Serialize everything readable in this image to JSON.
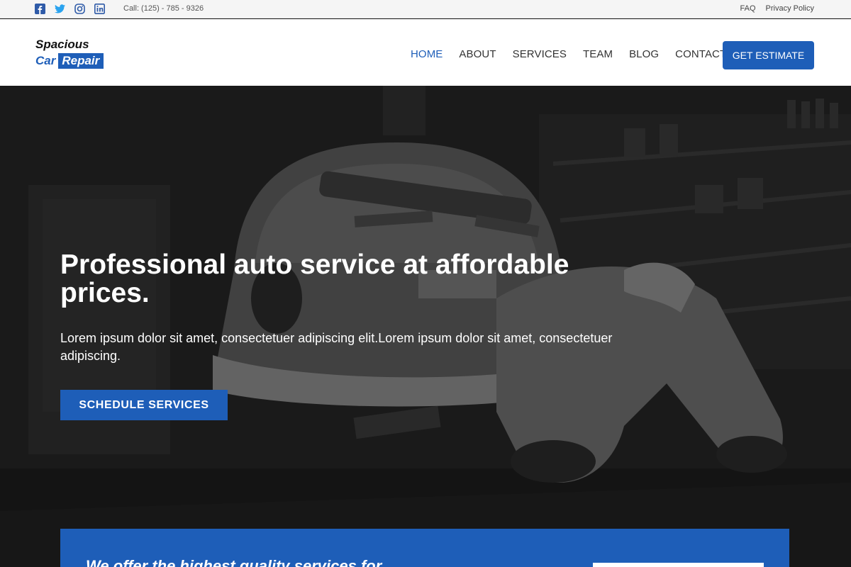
{
  "topbar": {
    "social": [
      {
        "icon": "facebook-icon"
      },
      {
        "icon": "twitter-icon"
      },
      {
        "icon": "instagram-icon"
      },
      {
        "icon": "linkedin-icon"
      }
    ],
    "phone": "Call: (125) - 785 - 9326",
    "links": [
      "FAQ",
      "Privacy Policy"
    ]
  },
  "header": {
    "logo_line1": "Spacious",
    "logo_car": "Car",
    "logo_repair": "Repair",
    "nav": [
      "HOME",
      "ABOUT",
      "SERVICES",
      "TEAM",
      "BLOG",
      "CONTACT"
    ],
    "active_nav": "HOME",
    "cta": "GET ESTIMATE"
  },
  "hero": {
    "title": "Professional auto service at affordable prices.",
    "subtitle": "Lorem ipsum dolor sit amet, consectetuer adipiscing elit.Lorem ipsum dolor sit amet, consectetuer adipiscing.",
    "button": "SCHEDULE SERVICES"
  },
  "offer": {
    "text": "We offer the highest quality services for"
  },
  "colors": {
    "brand": "#1e5eb8",
    "topbar_bg": "#f5f5f5",
    "header_bg": "#ffffff",
    "hero_dark": "#232323"
  }
}
